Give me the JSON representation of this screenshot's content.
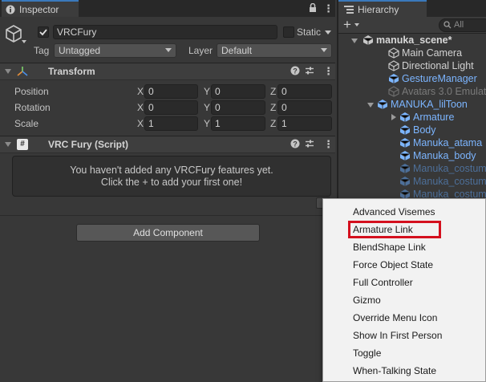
{
  "inspector": {
    "tab_label": "Inspector",
    "object_name": "VRCFury",
    "static_label": "Static",
    "tag_label": "Tag",
    "tag_value": "Untagged",
    "layer_label": "Layer",
    "layer_value": "Default",
    "transform": {
      "title": "Transform",
      "rows": [
        {
          "label": "Position",
          "x": "0",
          "y": "0",
          "z": "0"
        },
        {
          "label": "Rotation",
          "x": "0",
          "y": "0",
          "z": "0"
        },
        {
          "label": "Scale",
          "x": "1",
          "y": "1",
          "z": "1"
        }
      ],
      "axis_x": "X",
      "axis_y": "Y",
      "axis_z": "Z"
    },
    "vrcfury": {
      "title": "VRC Fury (Script)",
      "message_line1": "You haven't added any VRCFury features yet.",
      "message_line2": "Click the + to add your first one!"
    },
    "add_component_label": "Add Component"
  },
  "hierarchy": {
    "tab_label": "Hierarchy",
    "search_placeholder": "All",
    "items": [
      {
        "label": "manuka_scene*",
        "style": "scene"
      },
      {
        "label": "Main Camera",
        "style": "normal"
      },
      {
        "label": "Directional Light",
        "style": "normal"
      },
      {
        "label": "GestureManager",
        "style": "prefab"
      },
      {
        "label": "Avatars 3.0 Emulat",
        "style": "disabled"
      },
      {
        "label": "MANUKA_lilToon",
        "style": "prefab"
      },
      {
        "label": "Armature",
        "style": "prefab"
      },
      {
        "label": "Body",
        "style": "prefab"
      },
      {
        "label": "Manuka_atama",
        "style": "prefab"
      },
      {
        "label": "Manuka_body",
        "style": "prefab"
      },
      {
        "label": "Manuka_costum",
        "style": "prefab-disabled"
      },
      {
        "label": "Manuka_costum",
        "style": "prefab-disabled"
      },
      {
        "label": "Manuka_costum",
        "style": "prefab-disabled"
      }
    ]
  },
  "popup_menu": {
    "items": [
      "Advanced Visemes",
      "Armature Link",
      "BlendShape Link",
      "Force Object State",
      "Full Controller",
      "Gizmo",
      "Override Menu Icon",
      "Show In First Person",
      "Toggle",
      "When-Talking State"
    ],
    "highlighted": "Armature Link"
  },
  "colors": {
    "panel_bg": "#383838",
    "tab_accent": "#3a79bb",
    "prefab_text": "#7cb5ff",
    "highlight_box": "#d4101e",
    "popup_bg": "#f2f2f2"
  }
}
